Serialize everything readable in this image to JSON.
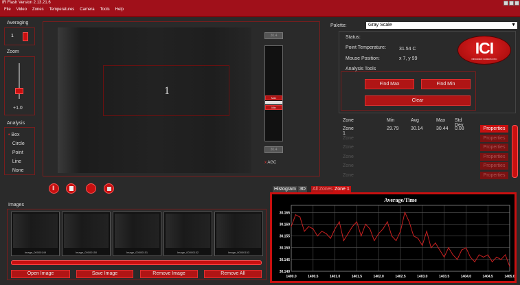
{
  "window": {
    "title": "IR Flash Version 2.13.21.6"
  },
  "menu": [
    "File",
    "Video",
    "Zones",
    "Temperatures",
    "Camera",
    "Tools",
    "Help"
  ],
  "averaging": {
    "label": "Averaging",
    "value": "1"
  },
  "zoom": {
    "label": "Zoom",
    "value": "+1.0"
  },
  "analysis": {
    "label": "Analysis",
    "options": [
      "Box",
      "Circle",
      "Point",
      "Line",
      "None"
    ],
    "selected": "Box"
  },
  "image_view": {
    "zone_label": "1"
  },
  "temp_scale": {
    "top": "30.4",
    "bottom": "30.4",
    "marker_high": "Max",
    "marker_low": "Min",
    "agc_label": "AGC"
  },
  "palette": {
    "label": "Palette:",
    "value": "Gray Scale"
  },
  "status": {
    "label": "Status:",
    "point_temp_label": "Point Temperature:",
    "point_temp_value": "31.54 C",
    "mouse_pos_label": "Mouse Position:",
    "mouse_pos_value": "x 7, y 99"
  },
  "logo": {
    "text": "ICI",
    "subtitle": "INFRARED CAMERAS INC"
  },
  "analysis_tools": {
    "label": "Analysis Tools",
    "find_max": "Find Max",
    "find_min": "Find Min",
    "clear": "Clear"
  },
  "zone_table": {
    "headers": [
      "Zone",
      "Min",
      "Avg",
      "Max",
      "Std Dev"
    ],
    "rows": [
      {
        "zone": "Zone 1",
        "min": "29.79",
        "avg": "30.14",
        "max": "30.44",
        "std": "0.08",
        "button": "Properties"
      },
      {
        "zone": "Zone",
        "min": "",
        "avg": "",
        "max": "",
        "std": "",
        "button": "Properties"
      },
      {
        "zone": "Zone",
        "min": "",
        "avg": "",
        "max": "",
        "std": "",
        "button": "Properties"
      },
      {
        "zone": "Zone",
        "min": "",
        "avg": "",
        "max": "",
        "std": "",
        "button": "Properties"
      },
      {
        "zone": "Zone",
        "min": "",
        "avg": "",
        "max": "",
        "std": "",
        "button": "Properties"
      },
      {
        "zone": "Zone",
        "min": "",
        "avg": "",
        "max": "",
        "std": "",
        "button": "Properties"
      }
    ]
  },
  "tabs": [
    "Histogram",
    "3D",
    "All Zones",
    "Zone 1"
  ],
  "images": {
    "label": "Images",
    "thumbs": [
      "Image_00000149",
      "Image_00000150",
      "Image_00000151",
      "Image_00000152",
      "Image_00000153"
    ]
  },
  "image_buttons": {
    "open": "Open Image",
    "save": "Save Image",
    "remove": "Remove Image",
    "remove_all": "Remove All"
  },
  "chart_data": {
    "type": "line",
    "title": "Average/Time",
    "xlabel": "",
    "ylabel": "",
    "xlim": [
      1400.0,
      1405.0
    ],
    "ylim": [
      30.14,
      30.168
    ],
    "x_ticks": [
      "1400.0",
      "1400.5",
      "1401.0",
      "1401.5",
      "1402.0",
      "1402.5",
      "1403.0",
      "1403.5",
      "1404.0",
      "1404.5",
      "1405.0"
    ],
    "y_ticks": [
      "30.140",
      "30.145",
      "30.150",
      "30.155",
      "30.160",
      "30.165"
    ],
    "series": [
      {
        "color": "#c82020",
        "x": [
          1400.0,
          1400.1,
          1400.2,
          1400.3,
          1400.4,
          1400.5,
          1400.6,
          1400.7,
          1400.8,
          1400.9,
          1401.0,
          1401.1,
          1401.2,
          1401.3,
          1401.4,
          1401.5,
          1401.6,
          1401.7,
          1401.8,
          1401.9,
          1402.0,
          1402.1,
          1402.2,
          1402.3,
          1402.4,
          1402.5,
          1402.6,
          1402.7,
          1402.8,
          1402.9,
          1403.0,
          1403.1,
          1403.2,
          1403.3,
          1403.4,
          1403.5,
          1403.6,
          1403.7,
          1403.8,
          1403.9,
          1404.0,
          1404.1,
          1404.2,
          1404.3,
          1404.4,
          1404.5,
          1404.6,
          1404.7,
          1404.8,
          1404.9,
          1405.0
        ],
        "values": [
          30.159,
          30.164,
          30.163,
          30.157,
          30.159,
          30.158,
          30.155,
          30.157,
          30.156,
          30.154,
          30.158,
          30.161,
          30.153,
          30.156,
          30.159,
          30.161,
          30.155,
          30.16,
          30.158,
          30.153,
          30.156,
          30.158,
          30.161,
          30.155,
          30.153,
          30.157,
          30.165,
          30.161,
          30.155,
          30.154,
          30.151,
          30.157,
          30.15,
          30.152,
          30.149,
          30.146,
          30.15,
          30.147,
          30.145,
          30.149,
          30.15,
          30.146,
          30.144,
          30.147,
          30.146,
          30.147,
          30.144,
          30.146,
          30.145,
          30.147,
          30.142
        ]
      }
    ]
  }
}
